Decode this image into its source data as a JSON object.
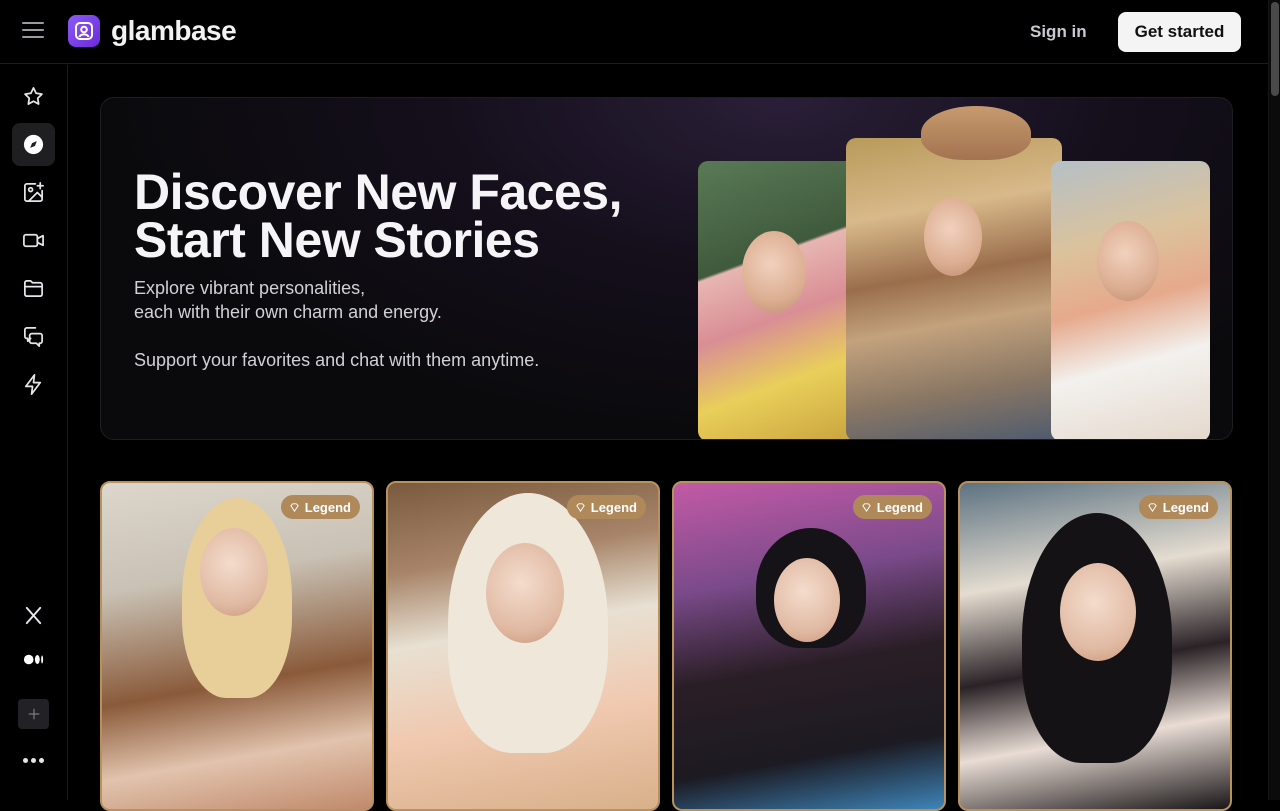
{
  "header": {
    "logo_text": "glambase",
    "signin_label": "Sign in",
    "getstarted_label": "Get started"
  },
  "sidebar": {
    "items": [
      {
        "icon": "star-icon"
      },
      {
        "icon": "compass-icon",
        "active": true
      },
      {
        "icon": "image-sparkle-icon"
      },
      {
        "icon": "video-icon"
      },
      {
        "icon": "folder-icon"
      },
      {
        "icon": "chat-icon"
      },
      {
        "icon": "lightning-icon"
      }
    ],
    "bottom": [
      {
        "icon": "x-logo-icon"
      },
      {
        "icon": "medium-logo-icon"
      },
      {
        "icon": "plus-icon"
      },
      {
        "icon": "more-dots-icon"
      }
    ]
  },
  "hero": {
    "title_line1": "Discover New Faces,",
    "title_line2": "Start New Stories",
    "subtitle_line1": "Explore vibrant personalities,",
    "subtitle_line2": "each with their own charm and energy.",
    "subtitle_line3": "Support your favorites and chat with them anytime."
  },
  "cards": [
    {
      "badge": "Legend"
    },
    {
      "badge": "Legend"
    },
    {
      "badge": "Legend"
    },
    {
      "badge": "Legend"
    }
  ],
  "colors": {
    "accent": "#7c3aed",
    "badge": "#b0895a",
    "card_border": "#b8915d"
  }
}
